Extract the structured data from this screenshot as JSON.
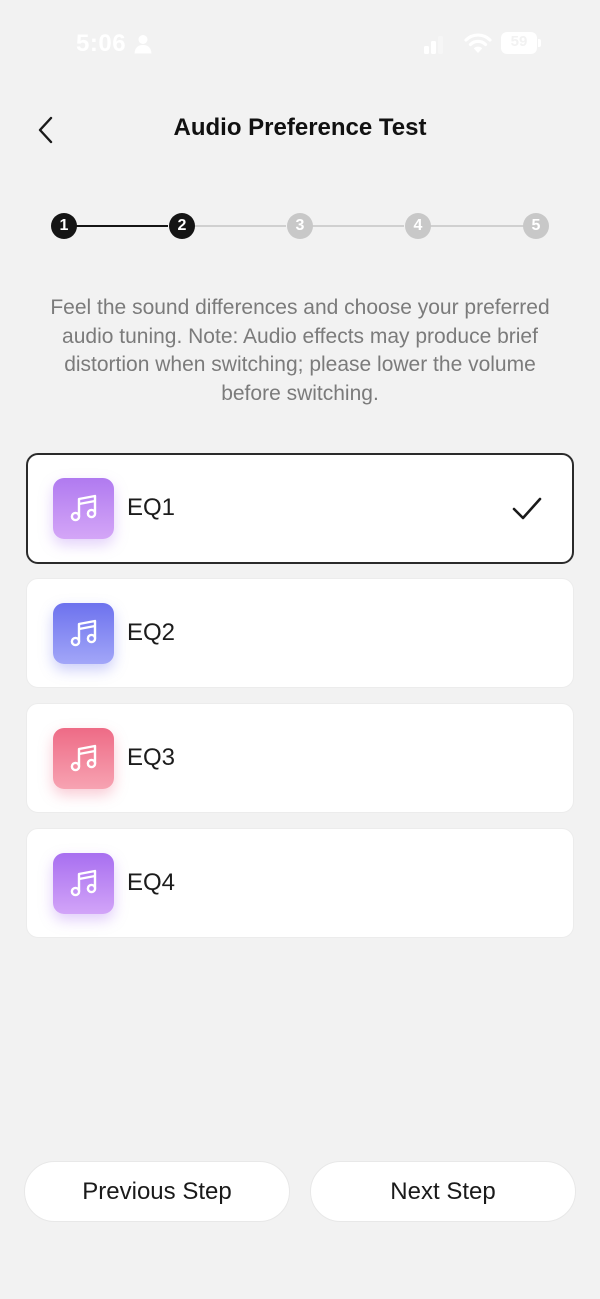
{
  "status_bar": {
    "time": "5:06",
    "battery": "59",
    "icons": [
      "person-icon",
      "signal-icon",
      "wifi-icon",
      "battery-icon"
    ]
  },
  "header": {
    "title": "Audio Preference Test",
    "back_icon": "chevron-left-icon"
  },
  "stepper": {
    "steps": [
      {
        "label": "1",
        "state": "done"
      },
      {
        "label": "2",
        "state": "current"
      },
      {
        "label": "3",
        "state": "todo"
      },
      {
        "label": "4",
        "state": "todo"
      },
      {
        "label": "5",
        "state": "todo"
      }
    ],
    "active_color": "#151515",
    "inactive_color": "#c8c8c8"
  },
  "description": "Feel the sound differences and choose your preferred audio tuning. Note: Audio effects may produce brief distortion when switching; please lower the volume before switching.",
  "eq_options": [
    {
      "label": "EQ1",
      "selected": true,
      "icon": "music-note-icon",
      "color_top": "#b07af0",
      "color_bottom": "#d4a6f7"
    },
    {
      "label": "EQ2",
      "selected": false,
      "icon": "music-note-icon",
      "color_top": "#6d72ee",
      "color_bottom": "#a2a6f8"
    },
    {
      "label": "EQ3",
      "selected": false,
      "icon": "music-note-icon",
      "color_top": "#ee6b86",
      "color_bottom": "#f7a3b2"
    },
    {
      "label": "EQ4",
      "selected": false,
      "icon": "music-note-icon",
      "color_top": "#a86ff0",
      "color_bottom": "#d2a4f8"
    }
  ],
  "selected_check_icon": "checkmark-icon",
  "buttons": {
    "previous": "Previous Step",
    "next": "Next Step"
  }
}
